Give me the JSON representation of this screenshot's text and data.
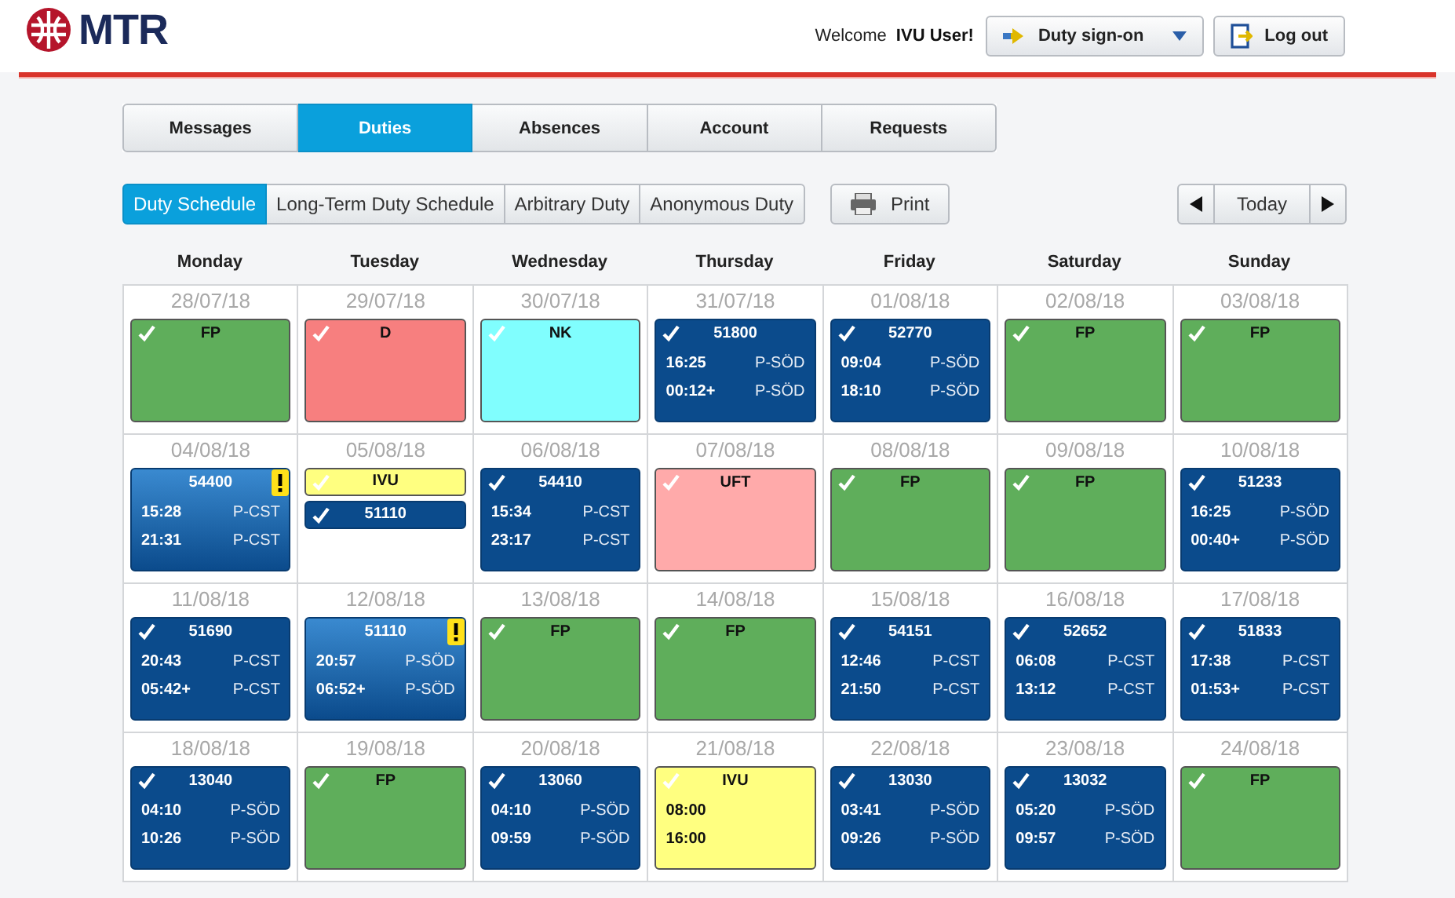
{
  "header": {
    "logo": "MTR",
    "welcome": "Welcome",
    "user": "IVU User!",
    "duty_menu": "Duty sign-on",
    "logout": "Log out"
  },
  "tabs": [
    {
      "label": "Messages",
      "selected": false
    },
    {
      "label": "Duties",
      "selected": true
    },
    {
      "label": "Absences",
      "selected": false
    },
    {
      "label": "Account",
      "selected": false
    },
    {
      "label": "Requests",
      "selected": false
    }
  ],
  "subtabs": [
    {
      "label": "Duty Schedule",
      "selected": true
    },
    {
      "label": "Long-Term Duty Schedule",
      "selected": false
    },
    {
      "label": "Arbitrary Duty",
      "selected": false
    },
    {
      "label": "Anonymous Duty",
      "selected": false
    }
  ],
  "print": "Print",
  "today": "Today",
  "weekdays": [
    "Monday",
    "Tuesday",
    "Wednesday",
    "Thursday",
    "Friday",
    "Saturday",
    "Sunday"
  ],
  "days": [
    {
      "date": "28/07/18",
      "entries": [
        {
          "kind": "absence",
          "code": "FP",
          "color": "#5fae5b"
        }
      ]
    },
    {
      "date": "29/07/18",
      "entries": [
        {
          "kind": "absence",
          "code": "D",
          "color": "#f77f7f"
        }
      ]
    },
    {
      "date": "30/07/18",
      "entries": [
        {
          "kind": "absence",
          "code": "NK",
          "color": "#80fefe"
        }
      ]
    },
    {
      "date": "31/07/18",
      "entries": [
        {
          "kind": "duty",
          "code": "51800",
          "warning": false,
          "rows": [
            {
              "time": "16:25",
              "place": "P-SÖD"
            },
            {
              "time": "00:12+",
              "place": "P-SÖD"
            }
          ]
        }
      ]
    },
    {
      "date": "01/08/18",
      "entries": [
        {
          "kind": "duty",
          "code": "52770",
          "warning": false,
          "rows": [
            {
              "time": "09:04",
              "place": "P-SÖD"
            },
            {
              "time": "18:10",
              "place": "P-SÖD"
            }
          ]
        }
      ]
    },
    {
      "date": "02/08/18",
      "entries": [
        {
          "kind": "absence",
          "code": "FP",
          "color": "#5fae5b"
        }
      ]
    },
    {
      "date": "03/08/18",
      "entries": [
        {
          "kind": "absence",
          "code": "FP",
          "color": "#5fae5b"
        }
      ]
    },
    {
      "date": "04/08/18",
      "entries": [
        {
          "kind": "duty",
          "code": "54400",
          "warning": true,
          "rows": [
            {
              "time": "15:28",
              "place": "P-CST"
            },
            {
              "time": "21:31",
              "place": "P-CST"
            }
          ]
        }
      ]
    },
    {
      "date": "05/08/18",
      "entries": [
        {
          "kind": "absence-chip",
          "code": "IVU",
          "color": "#ffff80"
        },
        {
          "kind": "duty-chip",
          "code": "51110",
          "warning": false
        }
      ]
    },
    {
      "date": "06/08/18",
      "entries": [
        {
          "kind": "duty",
          "code": "54410",
          "warning": false,
          "rows": [
            {
              "time": "15:34",
              "place": "P-CST"
            },
            {
              "time": "23:17",
              "place": "P-CST"
            }
          ]
        }
      ]
    },
    {
      "date": "07/08/18",
      "entries": [
        {
          "kind": "absence",
          "code": "UFT",
          "color": "#ffaaaa"
        }
      ]
    },
    {
      "date": "08/08/18",
      "entries": [
        {
          "kind": "absence",
          "code": "FP",
          "color": "#5fae5b"
        }
      ]
    },
    {
      "date": "09/08/18",
      "entries": [
        {
          "kind": "absence",
          "code": "FP",
          "color": "#5fae5b"
        }
      ]
    },
    {
      "date": "10/08/18",
      "entries": [
        {
          "kind": "duty",
          "code": "51233",
          "warning": false,
          "rows": [
            {
              "time": "16:25",
              "place": "P-SÖD"
            },
            {
              "time": "00:40+",
              "place": "P-SÖD"
            }
          ]
        }
      ]
    },
    {
      "date": "11/08/18",
      "entries": [
        {
          "kind": "duty",
          "code": "51690",
          "warning": false,
          "rows": [
            {
              "time": "20:43",
              "place": "P-CST"
            },
            {
              "time": "05:42+",
              "place": "P-CST"
            }
          ]
        }
      ]
    },
    {
      "date": "12/08/18",
      "entries": [
        {
          "kind": "duty",
          "code": "51110",
          "warning": true,
          "rows": [
            {
              "time": "20:57",
              "place": "P-SÖD"
            },
            {
              "time": "06:52+",
              "place": "P-SÖD"
            }
          ]
        }
      ]
    },
    {
      "date": "13/08/18",
      "entries": [
        {
          "kind": "absence",
          "code": "FP",
          "color": "#5fae5b"
        }
      ]
    },
    {
      "date": "14/08/18",
      "entries": [
        {
          "kind": "absence",
          "code": "FP",
          "color": "#5fae5b"
        }
      ]
    },
    {
      "date": "15/08/18",
      "entries": [
        {
          "kind": "duty",
          "code": "54151",
          "warning": false,
          "rows": [
            {
              "time": "12:46",
              "place": "P-CST"
            },
            {
              "time": "21:50",
              "place": "P-CST"
            }
          ]
        }
      ]
    },
    {
      "date": "16/08/18",
      "entries": [
        {
          "kind": "duty",
          "code": "52652",
          "warning": false,
          "rows": [
            {
              "time": "06:08",
              "place": "P-CST"
            },
            {
              "time": "13:12",
              "place": "P-CST"
            }
          ]
        }
      ]
    },
    {
      "date": "17/08/18",
      "entries": [
        {
          "kind": "duty",
          "code": "51833",
          "warning": false,
          "rows": [
            {
              "time": "17:38",
              "place": "P-CST"
            },
            {
              "time": "01:53+",
              "place": "P-CST"
            }
          ]
        }
      ]
    },
    {
      "date": "18/08/18",
      "entries": [
        {
          "kind": "duty",
          "code": "13040",
          "warning": false,
          "rows": [
            {
              "time": "04:10",
              "place": "P-SÖD"
            },
            {
              "time": "10:26",
              "place": "P-SÖD"
            }
          ]
        }
      ]
    },
    {
      "date": "19/08/18",
      "entries": [
        {
          "kind": "absence",
          "code": "FP",
          "color": "#5fae5b"
        }
      ]
    },
    {
      "date": "20/08/18",
      "entries": [
        {
          "kind": "duty",
          "code": "13060",
          "warning": false,
          "rows": [
            {
              "time": "04:10",
              "place": "P-SÖD"
            },
            {
              "time": "09:59",
              "place": "P-SÖD"
            }
          ]
        }
      ]
    },
    {
      "date": "21/08/18",
      "entries": [
        {
          "kind": "absence",
          "code": "IVU",
          "color": "#ffff80",
          "rows": [
            {
              "time": "08:00"
            },
            {
              "time": "16:00"
            }
          ]
        }
      ]
    },
    {
      "date": "22/08/18",
      "entries": [
        {
          "kind": "duty",
          "code": "13030",
          "warning": false,
          "rows": [
            {
              "time": "03:41",
              "place": "P-SÖD"
            },
            {
              "time": "09:26",
              "place": "P-SÖD"
            }
          ]
        }
      ]
    },
    {
      "date": "23/08/18",
      "entries": [
        {
          "kind": "duty",
          "code": "13032",
          "warning": false,
          "rows": [
            {
              "time": "05:20",
              "place": "P-SÖD"
            },
            {
              "time": "09:57",
              "place": "P-SÖD"
            }
          ]
        }
      ]
    },
    {
      "date": "24/08/18",
      "entries": [
        {
          "kind": "absence",
          "code": "FP",
          "color": "#5fae5b"
        }
      ]
    }
  ]
}
